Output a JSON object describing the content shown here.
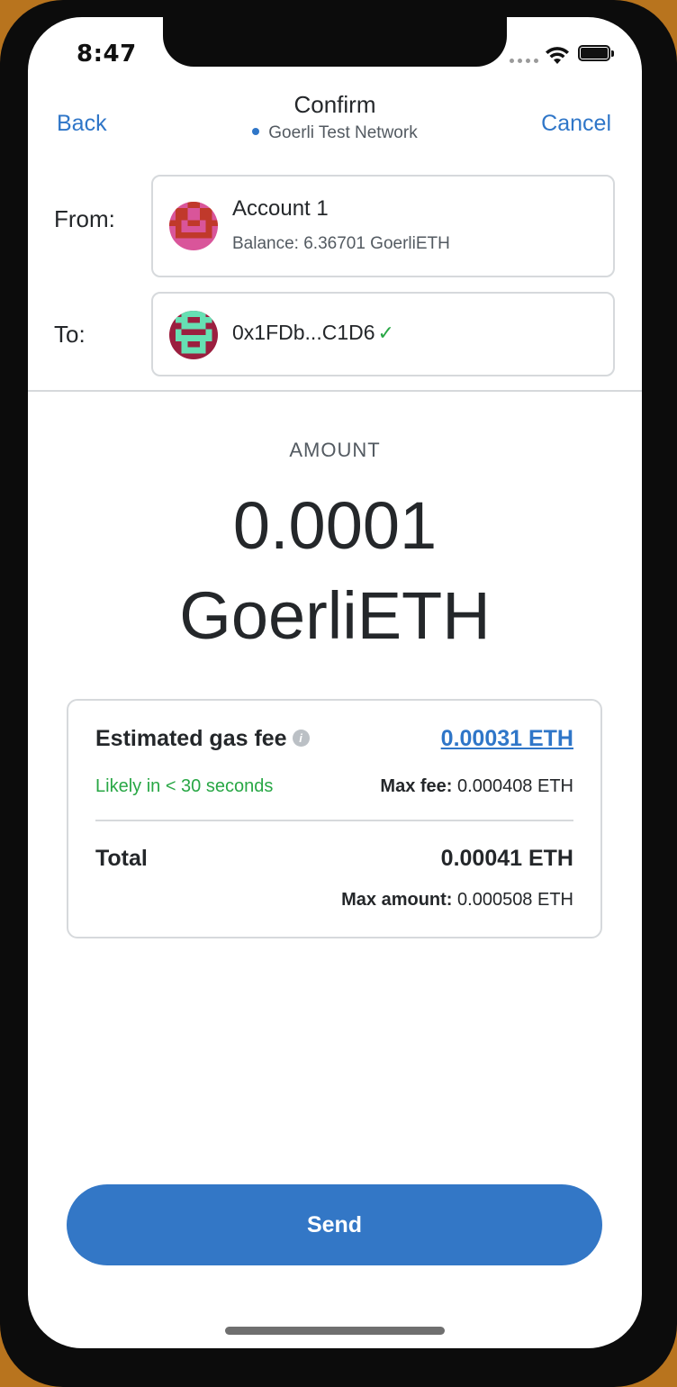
{
  "status_bar": {
    "time": "8:47"
  },
  "header": {
    "back_label": "Back",
    "title": "Confirm",
    "network": "Goerli Test Network",
    "cancel_label": "Cancel"
  },
  "from": {
    "label": "From:",
    "account_name": "Account 1",
    "balance": "Balance: 6.36701 GoerliETH"
  },
  "to": {
    "label": "To:",
    "address": "0x1FDb...C1D6",
    "verified_icon": "check-icon"
  },
  "amount": {
    "label": "AMOUNT",
    "value": "0.0001",
    "unit": "GoerliETH"
  },
  "gas": {
    "title": "Estimated gas fee",
    "fee": "0.00031 ETH",
    "time_estimate": "Likely in < 30 seconds",
    "max_fee_label": "Max fee:",
    "max_fee_value": "0.000408 ETH"
  },
  "total": {
    "label": "Total",
    "value": "0.00041 ETH",
    "max_label": "Max amount:",
    "max_value": "0.000508 ETH"
  },
  "send_label": "Send",
  "colors": {
    "accent": "#3377c6",
    "link": "#2f76c8",
    "success": "#28a745",
    "text": "#24272a"
  }
}
